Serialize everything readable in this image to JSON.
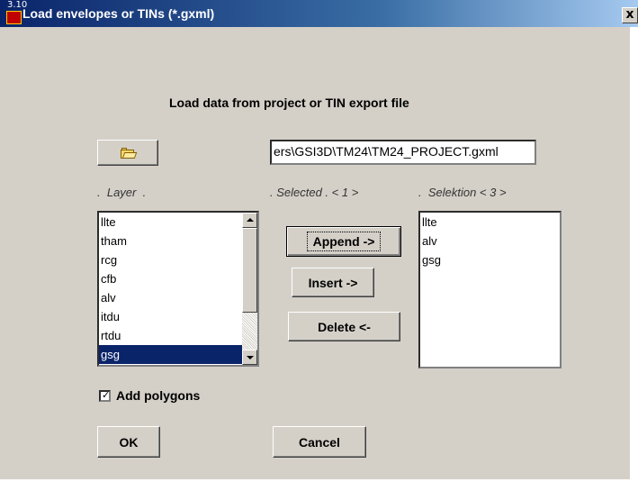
{
  "window": {
    "title": "Load envelopes or TINs (*.gxml)",
    "app_icon_label": "3.10",
    "close_label": "x"
  },
  "heading": "Load data from project or TIN export file",
  "file": {
    "open_icon": "folder-open-icon",
    "path": "ers\\GSI3D\\TM24\\TM24_PROJECT.gxml"
  },
  "labels": {
    "layer": ".  Layer  .",
    "selected": ". Selected . < 1 >",
    "selektion": ".  Selektion < 3 >"
  },
  "layer_list": {
    "items": [
      "llte",
      "tham",
      "rcg",
      "cfb",
      "alv",
      "itdu",
      "rtdu",
      "gsg"
    ],
    "selected": "gsg"
  },
  "selection_list": {
    "items": [
      "llte",
      "alv",
      "gsg"
    ]
  },
  "buttons": {
    "append": "Append  ->",
    "insert": "Insert ->",
    "delete": "Delete  <-",
    "ok": "OK",
    "cancel": "Cancel"
  },
  "options": {
    "add_polygons_label": "Add polygons",
    "add_polygons_checked": true
  },
  "colors": {
    "titlebar_start": "#0a246a",
    "titlebar_end": "#a6caf0",
    "dialog_face": "#d4d0c8",
    "selection_highlight": "#0a246a"
  }
}
